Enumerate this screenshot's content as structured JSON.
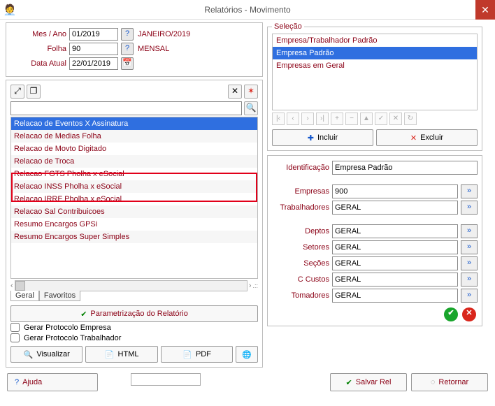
{
  "window": {
    "title": "Relatórios - Movimento"
  },
  "params": {
    "mesano_label": "Mes / Ano",
    "mesano": "01/2019",
    "mesano_display": "JANEIRO/2019",
    "folha_label": "Folha",
    "folha": "90",
    "folha_display": "MENSAL",
    "data_label": "Data Atual",
    "data": "22/01/2019"
  },
  "reportList": [
    {
      "label": "Relacao de Eventos X Assinatura",
      "selected": true
    },
    {
      "label": "Relacao de Medias Folha"
    },
    {
      "label": "Relacao de Movto Digitado"
    },
    {
      "label": "Relacao de Troca"
    },
    {
      "label": "Relacao FGTS Pholha x eSocial",
      "hl": true
    },
    {
      "label": "Relacao INSS Pholha x eSocial",
      "hl": true
    },
    {
      "label": "Relacao IRRF Pholha x eSocial"
    },
    {
      "label": "Relacao Sal Contribuicoes"
    },
    {
      "label": "Resumo Encargos GPSi"
    },
    {
      "label": "Resumo Encargos Super Simples"
    }
  ],
  "tabs": {
    "geral": "Geral",
    "fav": "Favoritos"
  },
  "paramReport": "Parametrização do Relatório",
  "geraProtoEmp": "Gerar Protocolo Empresa",
  "geraProtoTrab": "Gerar Protocolo Trabalhador",
  "outputBtns": {
    "vis": "Visualizar",
    "html": "HTML",
    "pdf": "PDF"
  },
  "selecao": {
    "legend": "Seleção",
    "items": [
      {
        "label": "Empresa/Trabalhador Padrão"
      },
      {
        "label": "Empresa Padrão",
        "selected": true
      },
      {
        "label": "Empresas em Geral"
      }
    ],
    "incluir": "Incluir",
    "excluir": "Excluir"
  },
  "ident": {
    "label": "Identificação",
    "value": "Empresa Padrão",
    "empresas_l": "Empresas",
    "empresas": "900",
    "trab_l": "Trabalhadores",
    "trab": "GERAL",
    "deptos_l": "Deptos",
    "deptos": "GERAL",
    "setores_l": "Setores",
    "setores": "GERAL",
    "secoes_l": "Seções",
    "secoes": "GERAL",
    "ccustos_l": "C Custos",
    "ccustos": "GERAL",
    "tom_l": "Tomadores",
    "tom": "GERAL"
  },
  "footer": {
    "ajuda": "Ajuda",
    "salvar": "Salvar Rel",
    "retornar": "Retornar"
  }
}
